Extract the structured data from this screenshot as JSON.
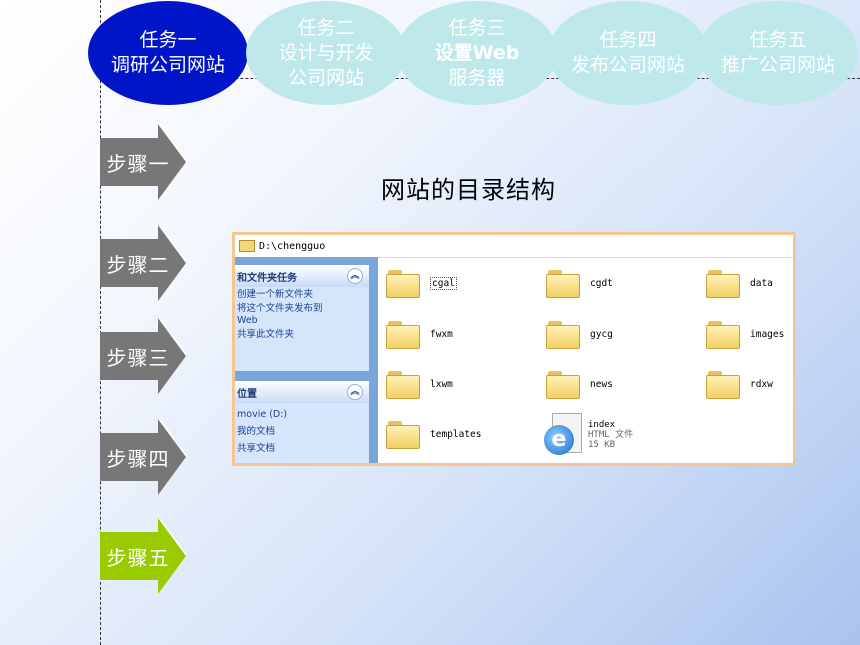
{
  "tasks": [
    {
      "line1": "任务一",
      "line2": "调研公司网站",
      "line3": "",
      "active": true
    },
    {
      "line1": "任务二",
      "line2": "设计与开发",
      "line3": "公司网站",
      "active": false
    },
    {
      "line1": "任务三",
      "line2": "设置Web",
      "line3": "服务器",
      "active": false
    },
    {
      "line1": "任务四",
      "line2": "发布公司网站",
      "line3": "",
      "active": false
    },
    {
      "line1": "任务五",
      "line2": "推广公司网站",
      "line3": "",
      "active": false
    }
  ],
  "steps": [
    {
      "label": "步骤一",
      "color": "#777777"
    },
    {
      "label": "步骤二",
      "color": "#777777"
    },
    {
      "label": "步骤三",
      "color": "#777777"
    },
    {
      "label": "步骤四",
      "color": "#777777"
    },
    {
      "label": "步骤五",
      "color": "#99cc00"
    }
  ],
  "heading": "网站的目录结构",
  "explorer": {
    "address": "D:\\chengguo",
    "tasks_panel": {
      "title": "和文件夹任务",
      "items": [
        "创建一个新文件夹",
        "将这个文件夹发布到",
        "Web",
        "共享此文件夹"
      ]
    },
    "places_panel": {
      "title": "位置",
      "items": [
        "movie (D:)",
        "我的文档",
        "共享文档"
      ]
    },
    "folders": [
      "cgal",
      "cgdt",
      "data",
      "fwxm",
      "gycg",
      "images",
      "lxwm",
      "news",
      "rdxw",
      "templates"
    ],
    "file": {
      "name": "index",
      "type": "HTML 文件",
      "size": "15 KB"
    }
  },
  "colors": {
    "active_task": "#0014c8",
    "idle_task": "#bfe8ea",
    "step_default": "#777777",
    "step_active": "#99cc00",
    "frame": "#f7c58f"
  }
}
